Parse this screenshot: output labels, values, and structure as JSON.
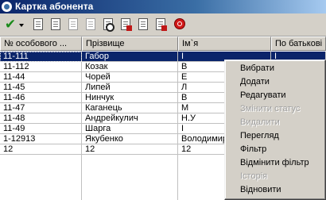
{
  "window": {
    "title": "Картка абонента"
  },
  "toolbar": {
    "buttons": [
      {
        "icon": "checkmark-icon"
      },
      {
        "icon": "dropdown-arrow-icon"
      },
      {
        "icon": "new-document-icon"
      },
      {
        "icon": "edit-document-icon"
      },
      {
        "icon": "copy-document-icon"
      },
      {
        "icon": "delete-document-icon"
      },
      {
        "icon": "find-icon"
      },
      {
        "icon": "print-icon"
      },
      {
        "icon": "export-icon"
      },
      {
        "icon": "import-icon"
      },
      {
        "icon": "close-stop-icon"
      }
    ]
  },
  "table": {
    "headers": [
      "№ особового ...",
      "Прізвище",
      "Ім`я",
      "По батькові"
    ],
    "rows": [
      [
        "11-111",
        "Габор",
        "І",
        "І"
      ],
      [
        "11-112",
        "Козак",
        "В",
        ""
      ],
      [
        "11-44",
        "Чорей",
        "Е",
        ""
      ],
      [
        "11-45",
        "Липей",
        "Л",
        ""
      ],
      [
        "11-46",
        "Нинчук",
        "В",
        ""
      ],
      [
        "11-47",
        "Каганець",
        "М",
        ""
      ],
      [
        "11-48",
        "Андрейкулич",
        "Н.У",
        ""
      ],
      [
        "11-49",
        "Шарга",
        "І",
        ""
      ],
      [
        "1-12913",
        "Якубенко",
        "Володимир",
        ""
      ],
      [
        "12",
        "12",
        "12",
        ""
      ]
    ],
    "selected_row": 0
  },
  "context_menu": {
    "items": [
      {
        "label": "Вибрати",
        "enabled": true
      },
      {
        "label": "Додати",
        "enabled": true
      },
      {
        "label": "Редагувати",
        "enabled": true
      },
      {
        "label": "Змінити статус",
        "enabled": false
      },
      {
        "label": "Видалити",
        "enabled": false
      },
      {
        "label": "Перегляд",
        "enabled": true
      },
      {
        "label": "Фільтр",
        "enabled": true
      },
      {
        "label": "Відмінити фільтр",
        "enabled": true
      },
      {
        "label": "Історія",
        "enabled": false
      },
      {
        "label": "Відновити",
        "enabled": true
      }
    ]
  },
  "colors": {
    "title_bar": "#0a246a",
    "selection": "#0a246a",
    "face": "#d4d0c8",
    "disabled_text": "#a0a0a0"
  }
}
